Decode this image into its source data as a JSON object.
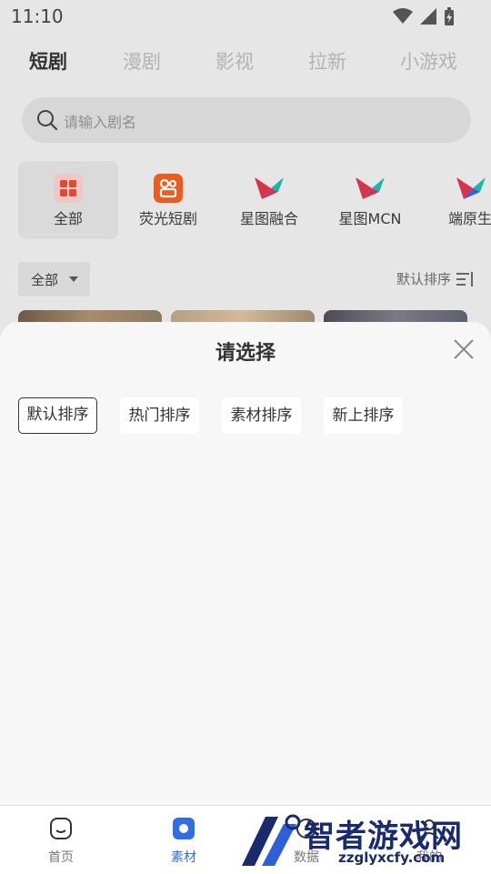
{
  "status_bar": {
    "time": "11:10"
  },
  "top_tabs": [
    "短剧",
    "漫剧",
    "影视",
    "拉新",
    "小游戏"
  ],
  "search": {
    "placeholder": "请输入剧名"
  },
  "categories": [
    {
      "label": "全部"
    },
    {
      "label": "荧光短剧"
    },
    {
      "label": "星图融合"
    },
    {
      "label": "星图MCN"
    },
    {
      "label": "端原生"
    }
  ],
  "filter": {
    "all_label": "全部",
    "sort_label": "默认排序"
  },
  "sheet": {
    "title": "请选择",
    "options": [
      "默认排序",
      "热门排序",
      "素材排序",
      "新上排序"
    ],
    "selected": "默认排序"
  },
  "bottom_nav": [
    {
      "label": "首页"
    },
    {
      "label": "素材"
    },
    {
      "label": "数据"
    },
    {
      "label": "我的"
    }
  ],
  "watermark": {
    "text": "智者游戏网",
    "url": "zzglyxcfy.com"
  },
  "colors": {
    "accent": "#2f6ee6",
    "brand_orange": "#f05a1e",
    "star_red": "#d8324c",
    "star_teal": "#1bb6a5"
  }
}
